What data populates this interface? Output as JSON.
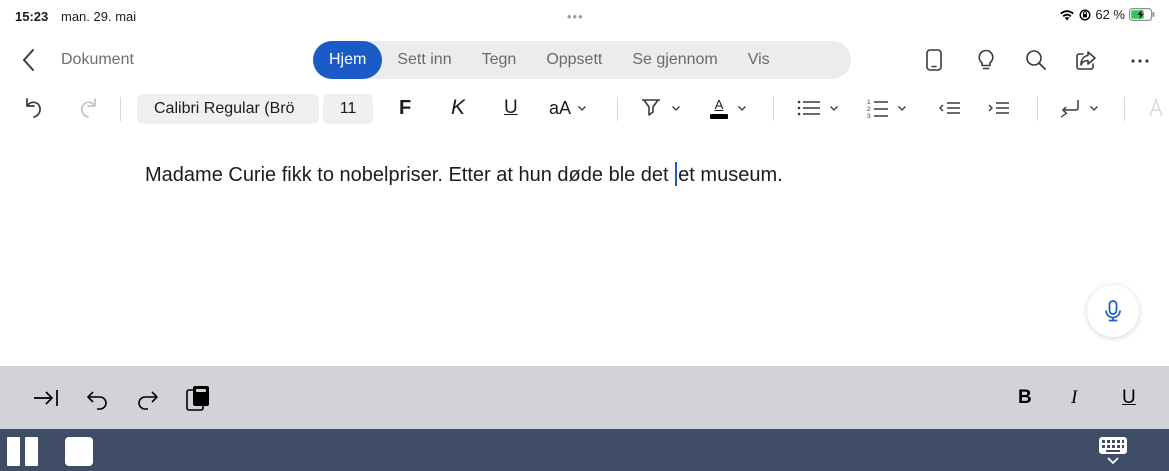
{
  "status_bar": {
    "time": "15:23",
    "date": "man. 29. mai",
    "dots": "•••",
    "battery_percent": "62 %"
  },
  "nav": {
    "doc_title": "Dokument",
    "tabs": [
      {
        "label": "Hjem",
        "active": true
      },
      {
        "label": "Sett inn",
        "active": false
      },
      {
        "label": "Tegn",
        "active": false
      },
      {
        "label": "Oppsett",
        "active": false
      },
      {
        "label": "Se gjennom",
        "active": false
      },
      {
        "label": "Vis",
        "active": false
      }
    ],
    "icons": [
      "phone-view-icon",
      "lightbulb-icon",
      "search-icon",
      "share-icon",
      "more-icon"
    ]
  },
  "format": {
    "font_name": "Calibri Regular (Brö",
    "font_size": "11",
    "bold_label": "F",
    "italic_label": "K",
    "underline_label": "U",
    "case_label": "aA",
    "font_color_letter": "A"
  },
  "document": {
    "text_before_caret": "Madame Curie fikk to nobelpriser. Etter at hun døde ble det ",
    "text_after_caret": "et museum."
  },
  "keyboard_bar": {
    "bold": "B",
    "italic": "I",
    "underline": "U"
  },
  "colors": {
    "accent": "#1b5bc7",
    "keyboard_bar": "#d2d3d8",
    "dock": "#3e4c66"
  }
}
